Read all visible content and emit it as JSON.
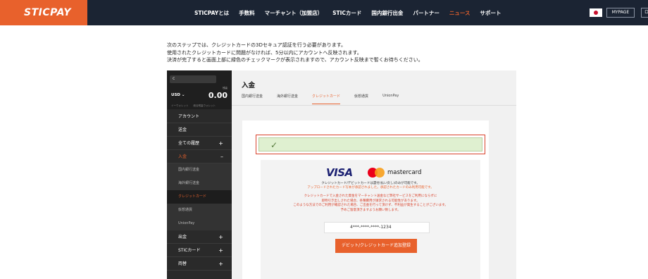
{
  "header": {
    "logo": "STICPAY",
    "nav": [
      {
        "label": "STICPAYとは",
        "active": false
      },
      {
        "label": "手数料",
        "active": false
      },
      {
        "label": "マーチャント（加盟店）",
        "active": false
      },
      {
        "label": "STICカード",
        "active": false
      },
      {
        "label": "国内銀行出金",
        "active": false
      },
      {
        "label": "パートナー",
        "active": false
      },
      {
        "label": "ニュース",
        "active": true
      },
      {
        "label": "サポート",
        "active": false
      }
    ],
    "mypage": "MYPAGE",
    "login": "ロ"
  },
  "intro": [
    "次のステップでは、クレジットカードの3Dセキュア認証を行う必要があります。",
    "使用されたクレジットカードに問題がなければ、5分以内にアカウントへ反映されます。",
    "決済が完了すると画面上部に緑色のチェックマークが表示されますので、アカウント反映まで暫くお待ちください。"
  ],
  "app": {
    "search_text": "c",
    "currency": "USD",
    "balance_label": "残高",
    "balance": "0.00",
    "side_links": "イーウォレット　　総合残高ウォレット",
    "menu": {
      "account": "アカウント",
      "remit": "送金",
      "history": "全ての履歴",
      "deposit": "入金",
      "sub_domestic": "国内銀行送金",
      "sub_overseas": "海外銀行送金",
      "sub_credit": "クレジットカード",
      "sub_crypto": "仮想通貨",
      "sub_unionpay": "UnionPay",
      "withdraw": "出金",
      "sticcard": "STICカード",
      "exchange": "両替"
    },
    "page_title": "入金",
    "tabs": [
      {
        "label": "国内銀行送金",
        "active": false
      },
      {
        "label": "海外銀行送金",
        "active": false
      },
      {
        "label": "クレジットカード",
        "active": true
      },
      {
        "label": "仮想通貨",
        "active": false
      },
      {
        "label": "UnionPay",
        "active": false
      }
    ],
    "card": {
      "visa": "VISA",
      "mastercard": "mastercard",
      "line1": "クレジットカード/デビットカードは還付(払い戻し)のみが可能です。",
      "line2": "アップロードされたカード写本が承認されました。承認されたカードのみ利用可能です。",
      "warn": [
        "クレジットカードで入金された資金をマーチャント送金など弊社サービスをご利用にならずに",
        "即時引き出しされた場合、各種費用が請求される可能性があります。",
        "このような方法でのご利用が確認された場合、ご出金を行って頂けず、不利益が発生することがございます。",
        "予めご留意頂きますようお願い致します。"
      ],
      "card_number": "4***-****-****-1234",
      "add_button": "デビット/クレジットカード追加登録"
    }
  },
  "colors": {
    "brand": "#e8612c",
    "header_bg": "#1b2433",
    "success_bg": "#dff0d0",
    "highlight_border": "#d9422b"
  }
}
